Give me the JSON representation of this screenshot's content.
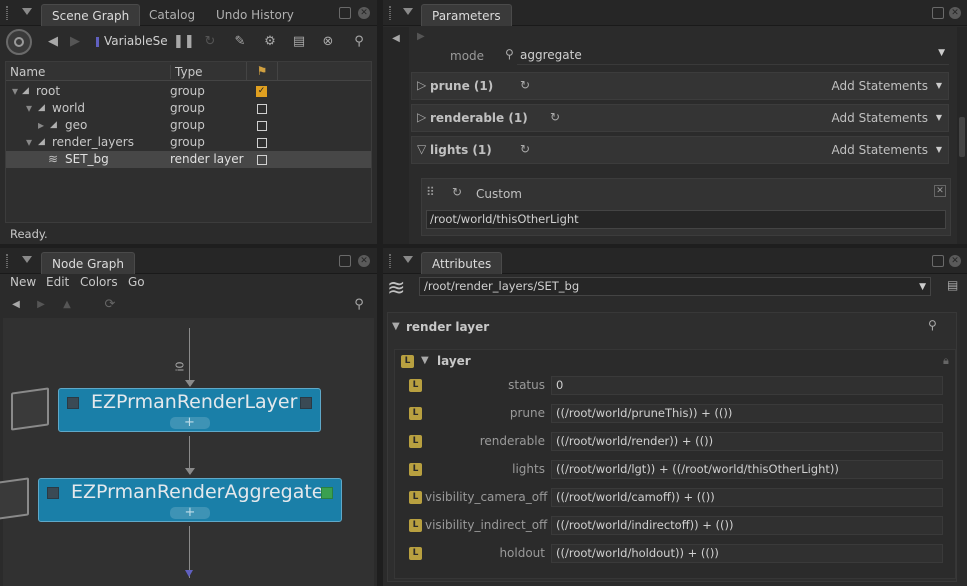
{
  "scene_graph": {
    "tabs": [
      "Scene Graph",
      "Catalog",
      "Undo History"
    ],
    "variable_label": "VariableSe",
    "columns": [
      "Name",
      "Type"
    ],
    "rows": [
      {
        "name": "root",
        "type": "group",
        "checked": true
      },
      {
        "name": "world",
        "type": "group",
        "checked": false
      },
      {
        "name": "geo",
        "type": "group",
        "checked": false
      },
      {
        "name": "render_layers",
        "type": "group",
        "checked": false
      },
      {
        "name": "SET_bg",
        "type": "render layer",
        "checked": false
      }
    ],
    "status": "Ready."
  },
  "parameters": {
    "tab": "Parameters",
    "mode_label": "mode",
    "mode_value": "aggregate",
    "sections": [
      {
        "label": "prune (1)",
        "add": "Add Statements"
      },
      {
        "label": "renderable (1)",
        "add": "Add Statements"
      },
      {
        "label": "lights (1)",
        "add": "Add Statements"
      }
    ],
    "custom_label": "Custom",
    "custom_path": "/root/world/thisOtherLight"
  },
  "node_graph": {
    "tab": "Node Graph",
    "menu": [
      "New",
      "Edit",
      "Colors",
      "Go"
    ],
    "port_label": "i0",
    "nodes": [
      {
        "title": "EZPrmanRenderLayer"
      },
      {
        "title": "EZPrmanRenderAggregate"
      }
    ]
  },
  "attributes": {
    "tab": "Attributes",
    "path": "/root/render_layers/SET_bg",
    "group_label": "render layer",
    "sub_label": "layer",
    "badge": "L",
    "rows": [
      {
        "name": "status",
        "value": "0"
      },
      {
        "name": "prune",
        "value": "((/root/world/pruneThis)) + (())"
      },
      {
        "name": "renderable",
        "value": "((/root/world/render)) + (())"
      },
      {
        "name": "lights",
        "value": "((/root/world/lgt)) + ((/root/world/thisOtherLight))"
      },
      {
        "name": "visibility_camera_off",
        "value": "((/root/world/camoff)) + (())"
      },
      {
        "name": "visibility_indirect_off",
        "value": "((/root/world/indirectoff)) + (())"
      },
      {
        "name": "holdout",
        "value": "((/root/world/holdout)) + (())"
      }
    ]
  },
  "colors": {
    "node_blue": "#1a7fa8",
    "badge": "#b8a040",
    "check": "#e0a020",
    "green": "#3aa050"
  }
}
